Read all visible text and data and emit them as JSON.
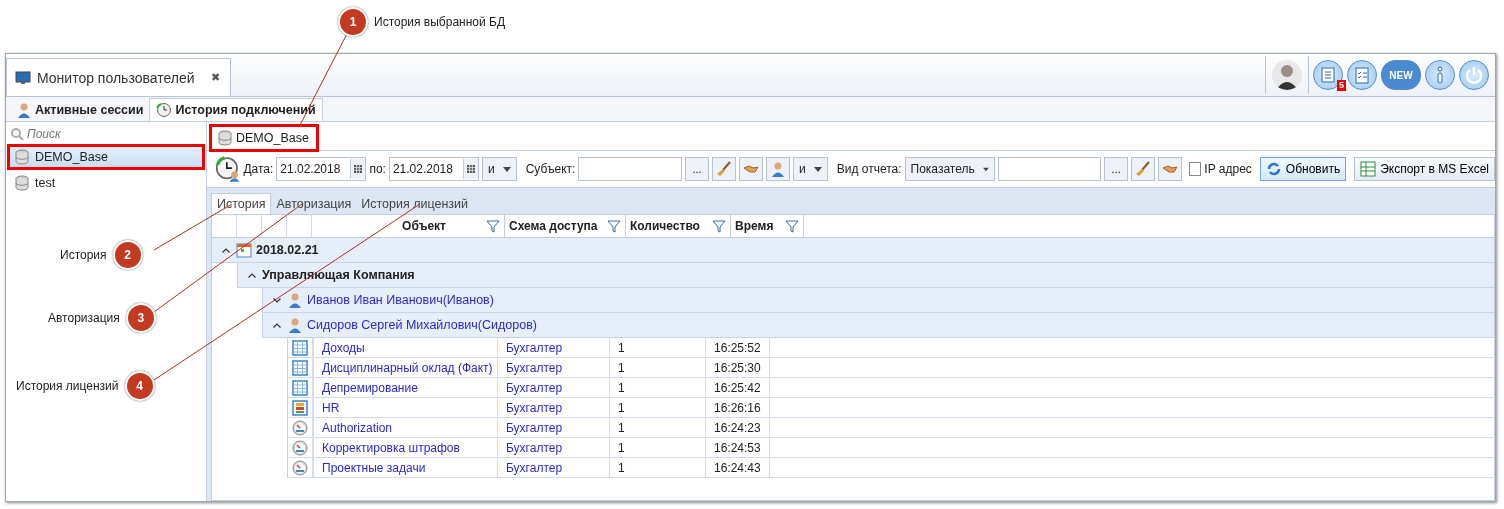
{
  "callouts": [
    {
      "number": "1",
      "label": "История выбранной БД"
    },
    {
      "number": "2",
      "label": "История"
    },
    {
      "number": "3",
      "label": "Авторизация"
    },
    {
      "number": "4",
      "label": "История лицензий"
    }
  ],
  "window": {
    "doc_tab": {
      "title": "Монитор пользователей",
      "close": "✖"
    },
    "notification_badge": "5",
    "new_label": "NEW"
  },
  "tabs": [
    {
      "label": "Активные сессии",
      "selected": false
    },
    {
      "label": "История подключений",
      "selected": true
    }
  ],
  "sidebar": {
    "search_placeholder": "Поиск",
    "items": [
      {
        "label": "DEMO_Base",
        "selected": true,
        "highlighted": true
      },
      {
        "label": "test",
        "selected": false,
        "highlighted": false
      }
    ]
  },
  "db_tab": {
    "label": "DEMO_Base",
    "highlighted": true
  },
  "filter": {
    "date_label": "Дата:",
    "date_from": "21.02.2018",
    "to_label": "по:",
    "date_to": "21.02.2018",
    "logic_1": "и",
    "subject_label": "Субъект:",
    "more_1": "...",
    "logic_2": "и",
    "report_label": "Вид отчета:",
    "report_type": "Показатель",
    "more_2": "...",
    "ip_label": "IP адрес",
    "ip_checked": false,
    "refresh": "Обновить",
    "export": "Экспорт в MS Excel"
  },
  "subtabs": [
    {
      "label": "История",
      "selected": true
    },
    {
      "label": "Авторизация",
      "selected": false
    },
    {
      "label": "История лицензий",
      "selected": false
    }
  ],
  "table": {
    "columns": [
      "Объект",
      "Схема доступа",
      "Количество",
      "Время"
    ],
    "groups": [
      {
        "label": "2018.02.21",
        "expanded": true,
        "children": [
          {
            "label": "Управляющая Компания",
            "expanded": true,
            "children": [
              {
                "label": "Иванов Иван Иванович(Иванов)",
                "expanded": false
              },
              {
                "label": "Сидоров Сергей Михайлович(Сидоров)",
                "expanded": true,
                "rows": [
                  {
                    "kind": "table",
                    "object": "Доходы",
                    "scheme": "Бухгалтер",
                    "count": "1",
                    "time": "16:25:52"
                  },
                  {
                    "kind": "table",
                    "object": "Дисциплинарный оклад (Факт)",
                    "scheme": "Бухгалтер",
                    "count": "1",
                    "time": "16:25:30"
                  },
                  {
                    "kind": "table",
                    "object": "Депремирование",
                    "scheme": "Бухгалтер",
                    "count": "1",
                    "time": "16:25:42"
                  },
                  {
                    "kind": "hr",
                    "object": "HR",
                    "scheme": "Бухгалтер",
                    "count": "1",
                    "time": "16:26:16"
                  },
                  {
                    "kind": "gauge",
                    "object": "Authorization",
                    "scheme": "Бухгалтер",
                    "count": "1",
                    "time": "16:24:23"
                  },
                  {
                    "kind": "gauge",
                    "object": "Корректировка штрафов",
                    "scheme": "Бухгалтер",
                    "count": "1",
                    "time": "16:24:53"
                  },
                  {
                    "kind": "gauge",
                    "object": "Проектные задачи",
                    "scheme": "Бухгалтер",
                    "count": "1",
                    "time": "16:24:43"
                  }
                ]
              }
            ]
          }
        ]
      }
    ]
  }
}
